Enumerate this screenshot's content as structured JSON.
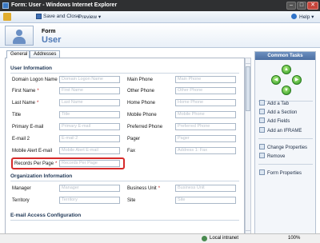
{
  "window": {
    "title": "Form: User - Windows Internet Explorer"
  },
  "toolbar": {
    "save_close": "Save and Close",
    "preview": "Preview ▾",
    "help": "Help ▾"
  },
  "header": {
    "form_label": "Form",
    "entity_name": "User"
  },
  "tabs": [
    {
      "label": "General"
    },
    {
      "label": "Addresses"
    }
  ],
  "sections": {
    "user_info": "User Information",
    "org_info": "Organization Information",
    "email_config": "E-mail Access Configuration"
  },
  "fields": {
    "domain_logon": {
      "label": "Domain Logon Name",
      "placeholder": "Domain Logon Name",
      "required": "*"
    },
    "main_phone": {
      "label": "Main Phone",
      "placeholder": "Main Phone"
    },
    "first_name": {
      "label": "First Name",
      "placeholder": "First Name",
      "required": "*"
    },
    "other_phone": {
      "label": "Other Phone",
      "placeholder": "Other Phone"
    },
    "last_name": {
      "label": "Last Name",
      "placeholder": "Last Name",
      "required": "*"
    },
    "home_phone": {
      "label": "Home Phone",
      "placeholder": "Home Phone"
    },
    "title": {
      "label": "Title",
      "placeholder": "Title"
    },
    "mobile_phone": {
      "label": "Mobile Phone",
      "placeholder": "Mobile Phone"
    },
    "primary_email": {
      "label": "Primary E-mail",
      "placeholder": "Primary E-mail"
    },
    "preferred_phone": {
      "label": "Preferred Phone",
      "placeholder": "Preferred Phone"
    },
    "email2": {
      "label": "E-mail 2",
      "placeholder": "E-mail 2"
    },
    "pager": {
      "label": "Pager",
      "placeholder": "Pager"
    },
    "mobile_alert_email": {
      "label": "Mobile Alert E-mail",
      "placeholder": "Mobile Alert E-mail"
    },
    "fax": {
      "label": "Fax",
      "placeholder": "Address 1: Fax"
    },
    "records_per_page": {
      "label": "Records Per Page",
      "placeholder": "Records Per Page",
      "required": "*"
    },
    "manager": {
      "label": "Manager",
      "placeholder": "Manager"
    },
    "business_unit": {
      "label": "Business Unit",
      "placeholder": "Business Unit",
      "required": "*"
    },
    "territory": {
      "label": "Territory",
      "placeholder": "Territory"
    },
    "site": {
      "label": "Site",
      "placeholder": "Site"
    }
  },
  "tasks": {
    "header": "Common Tasks",
    "items": [
      {
        "label": "Add a Tab"
      },
      {
        "label": "Add a Section"
      },
      {
        "label": "Add Fields"
      },
      {
        "label": "Add an IFRAME"
      },
      {
        "label": "Change Properties"
      },
      {
        "label": "Remove"
      },
      {
        "label": "Form Properties"
      }
    ]
  },
  "statusbar": {
    "zone": "Local intranet",
    "zoom": "100%"
  }
}
